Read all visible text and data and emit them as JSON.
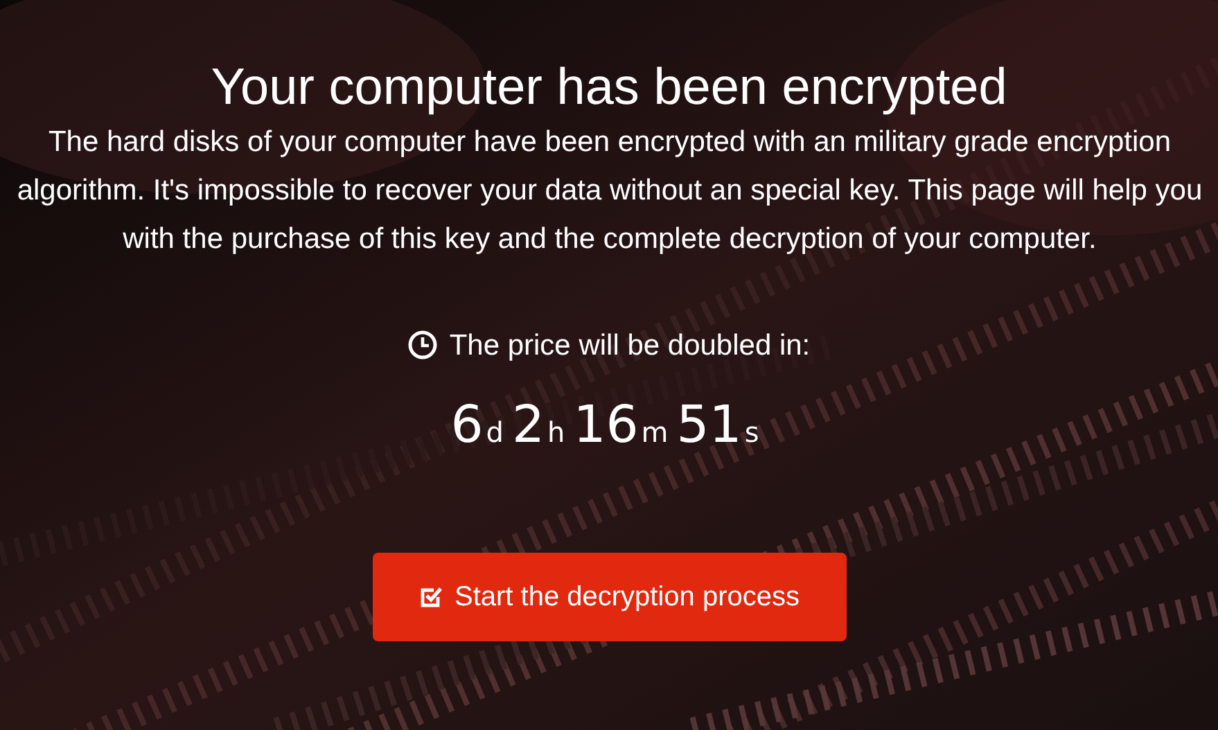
{
  "title": "Your computer has been encrypted",
  "message": "The hard disks of your computer have been encrypted with an military grade encryption algorithm. It's impossible to recover your data without an special key. This page will help you with the purchase of this key and the complete decryption of your computer.",
  "countdown_label": "The price will be doubled in:",
  "countdown": [
    {
      "value": "6",
      "unit": "d"
    },
    {
      "value": "2",
      "unit": "h"
    },
    {
      "value": "16",
      "unit": "m"
    },
    {
      "value": "51",
      "unit": "s"
    }
  ],
  "action_button": "Start the decryption process"
}
